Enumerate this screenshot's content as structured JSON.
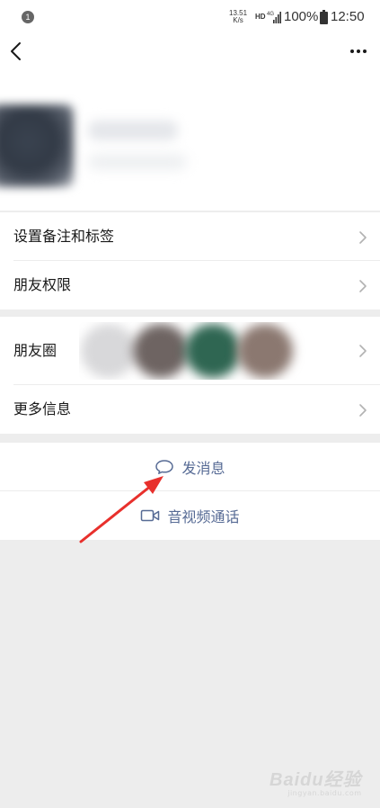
{
  "status_bar": {
    "notification_count": "1",
    "net_speed_value": "13.51",
    "net_speed_unit": "K/s",
    "hd_label": "HD",
    "signal_label": "4G",
    "battery_percent": "100%",
    "time": "12:50"
  },
  "nav": {
    "back_icon": "chevron-left-icon",
    "more_icon": "ellipsis-icon"
  },
  "menu": {
    "remark_tags": "设置备注和标签",
    "friend_permissions": "朋友权限",
    "moments": "朋友圈",
    "more_info": "更多信息"
  },
  "actions": {
    "send_message": "发消息",
    "video_call": "音视频通话"
  },
  "watermark": {
    "brand": "Baidu经验",
    "url": "jingyan.baidu.com"
  },
  "colors": {
    "link_blue": "#576b95",
    "annotation_red": "#e8302c",
    "background": "#ededed"
  }
}
